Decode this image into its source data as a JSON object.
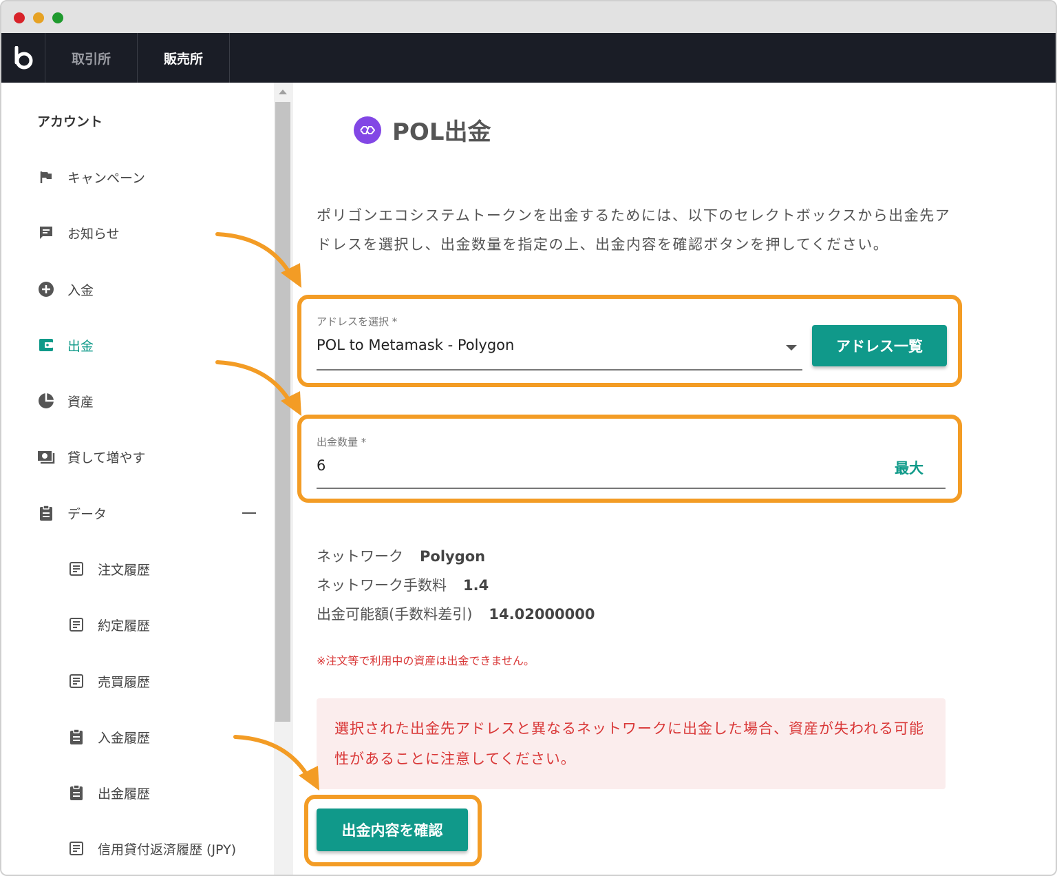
{
  "nav": {
    "tabs": [
      {
        "label": "取引所"
      },
      {
        "label": "販売所"
      }
    ]
  },
  "sidebar": {
    "heading": "アカウント",
    "items": [
      {
        "label": "キャンペーン",
        "icon": "flag-icon"
      },
      {
        "label": "お知らせ",
        "icon": "message-icon"
      },
      {
        "label": "入金",
        "icon": "plus-circle-icon"
      },
      {
        "label": "出金",
        "icon": "wallet-icon"
      },
      {
        "label": "資産",
        "icon": "pie-chart-icon"
      },
      {
        "label": "貸して増やす",
        "icon": "money-icon"
      },
      {
        "label": "データ",
        "icon": "clipboard-icon"
      }
    ],
    "sub_items": [
      {
        "label": "注文履歴",
        "icon": "document-icon"
      },
      {
        "label": "約定履歴",
        "icon": "document-icon"
      },
      {
        "label": "売買履歴",
        "icon": "document-icon"
      },
      {
        "label": "入金履歴",
        "icon": "clipboard-icon"
      },
      {
        "label": "出金履歴",
        "icon": "clipboard-icon"
      },
      {
        "label": "信用貸付返済履歴 (JPY)",
        "icon": "document-icon"
      }
    ]
  },
  "main": {
    "title": "POL出金",
    "intro": "ポリゴンエコシステムトークンを出金するためには、以下のセレクトボックスから出金先アドレスを選択し、出金数量を指定の上、出金内容を確認ボタンを押してください。",
    "address_field": {
      "label": "アドレスを選択 *",
      "value": "POL to Metamask - Polygon"
    },
    "address_list_button": "アドレス一覧",
    "amount_field": {
      "label": "出金数量 *",
      "value": "6"
    },
    "max_label": "最大",
    "info": [
      {
        "label": "ネットワーク",
        "value": "Polygon"
      },
      {
        "label": "ネットワーク手数料",
        "value": "1.4"
      },
      {
        "label": "出金可能額(手数料差引)",
        "value": "14.02000000"
      }
    ],
    "note": "※注文等で利用中の資産は出金できません。",
    "warning": "選択された出金先アドレスと異なるネットワークに出金した場合、資産が失われる可能性があることに注意してください。",
    "confirm_button": "出金内容を確認"
  },
  "colors": {
    "accent": "#10998a",
    "highlight": "#f39c25",
    "warning_text": "#d93838",
    "navbar": "#1a1d26",
    "polygon": "#8247e5"
  }
}
